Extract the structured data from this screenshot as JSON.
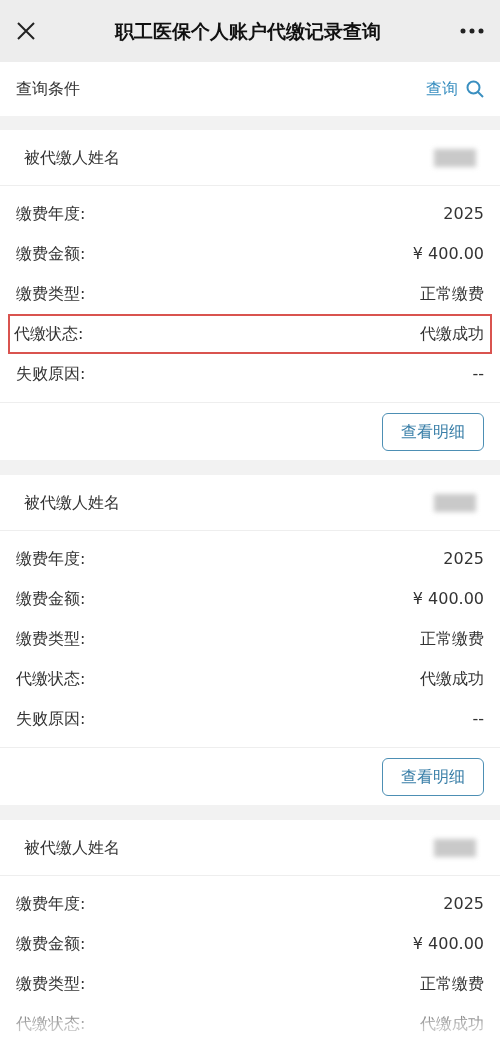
{
  "window": {
    "title": "职工医保个人账户代缴记录查询"
  },
  "query_bar": {
    "label": "查询条件",
    "action": "查询"
  },
  "records": [
    {
      "name_label": "被代缴人姓名",
      "name_redacted": true,
      "fields": [
        {
          "label": "缴费年度:",
          "value": "2025",
          "highlighted": false
        },
        {
          "label": "缴费金额:",
          "value": "¥ 400.00",
          "highlighted": false
        },
        {
          "label": "缴费类型:",
          "value": "正常缴费",
          "highlighted": false
        },
        {
          "label": "代缴状态:",
          "value": "代缴成功",
          "highlighted": true
        },
        {
          "label": "失败原因:",
          "value": "--",
          "highlighted": false
        }
      ],
      "button": "查看明细"
    },
    {
      "name_label": "被代缴人姓名",
      "name_redacted": true,
      "fields": [
        {
          "label": "缴费年度:",
          "value": "2025",
          "highlighted": false
        },
        {
          "label": "缴费金额:",
          "value": "¥ 400.00",
          "highlighted": false
        },
        {
          "label": "缴费类型:",
          "value": "正常缴费",
          "highlighted": false
        },
        {
          "label": "代缴状态:",
          "value": "代缴成功",
          "highlighted": false
        },
        {
          "label": "失败原因:",
          "value": "--",
          "highlighted": false
        }
      ],
      "button": "查看明细"
    },
    {
      "name_label": "被代缴人姓名",
      "name_redacted": true,
      "fields": [
        {
          "label": "缴费年度:",
          "value": "2025",
          "highlighted": false
        },
        {
          "label": "缴费金额:",
          "value": "¥ 400.00",
          "highlighted": false
        },
        {
          "label": "缴费类型:",
          "value": "正常缴费",
          "highlighted": false
        },
        {
          "label": "代缴状态:",
          "value": "代缴成功",
          "highlighted": false
        }
      ]
    }
  ]
}
